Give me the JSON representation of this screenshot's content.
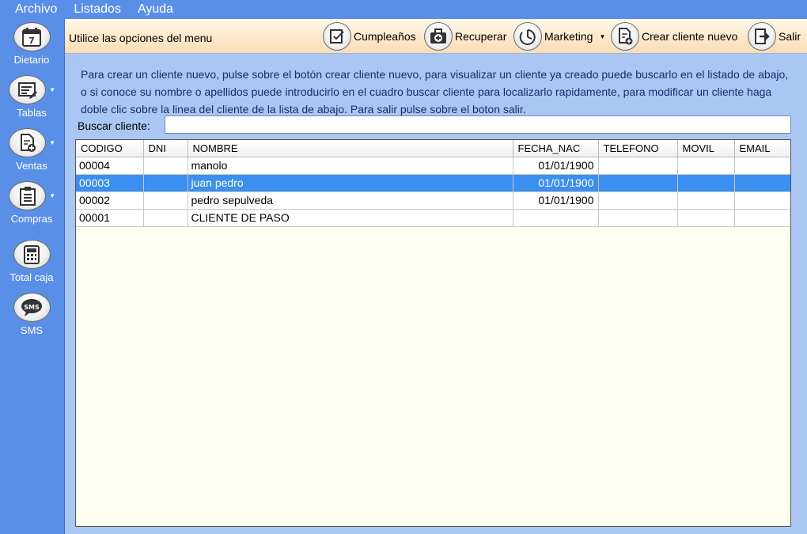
{
  "menu": {
    "items": [
      "Archivo",
      "Listados",
      "Ayuda"
    ]
  },
  "sidebar": {
    "items": [
      {
        "label": "Dietario",
        "icon": "calendar-icon"
      },
      {
        "label": "Tablas",
        "icon": "table-edit-icon"
      },
      {
        "label": "Ventas",
        "icon": "document-add-icon"
      },
      {
        "label": "Compras",
        "icon": "clipboard-icon"
      },
      {
        "label": "Total caja",
        "icon": "calculator-icon"
      },
      {
        "label": "SMS",
        "icon": "sms-icon"
      }
    ],
    "calendar_day": "7",
    "sms_text": "SMS"
  },
  "toolbar": {
    "hint": "Utilice las opciones del menu",
    "buttons": [
      {
        "label": "Cumpleaños",
        "icon": "birthday-note-icon"
      },
      {
        "label": "Recuperar",
        "icon": "first-aid-icon"
      },
      {
        "label": "Marketing",
        "icon": "marketing-dial-icon"
      },
      {
        "label": "Crear cliente nuevo",
        "icon": "new-client-doc-icon"
      },
      {
        "label": "Salir",
        "icon": "exit-icon"
      }
    ]
  },
  "info_text": "Para crear un cliente nuevo, pulse sobre el botón crear cliente nuevo, para visualizar un cliente ya creado puede buscarlo en el listado de abajo, o si conoce su nombre o apellidos puede introducirlo en el cuadro buscar cliente para localizarlo rapidamente, para modificar un cliente haga doble clic sobre la linea del cliente de la lista de abajo. Para salir pulse sobre el boton salir.",
  "search": {
    "label": "Buscar cliente:",
    "value": ""
  },
  "grid": {
    "columns": [
      "CODIGO",
      "DNI",
      "NOMBRE",
      "FECHA_NAC",
      "TELEFONO",
      "MOVIL",
      "EMAIL"
    ],
    "rows": [
      [
        "00004",
        "",
        "manolo",
        "01/01/1900",
        "",
        "",
        ""
      ],
      [
        "00003",
        "",
        "juan pedro",
        "01/01/1900",
        "",
        "",
        ""
      ],
      [
        "00002",
        "",
        "pedro sepulveda",
        "01/01/1900",
        "",
        "",
        ""
      ],
      [
        "00001",
        "",
        "CLIENTE DE PASO",
        "",
        "",
        "",
        ""
      ]
    ],
    "selected_row": "00003"
  },
  "colors": {
    "menubar": "#5a8fe8",
    "panel": "#a9c7f2",
    "selection": "#3b8ff0",
    "grid_bg": "#fffff0"
  }
}
